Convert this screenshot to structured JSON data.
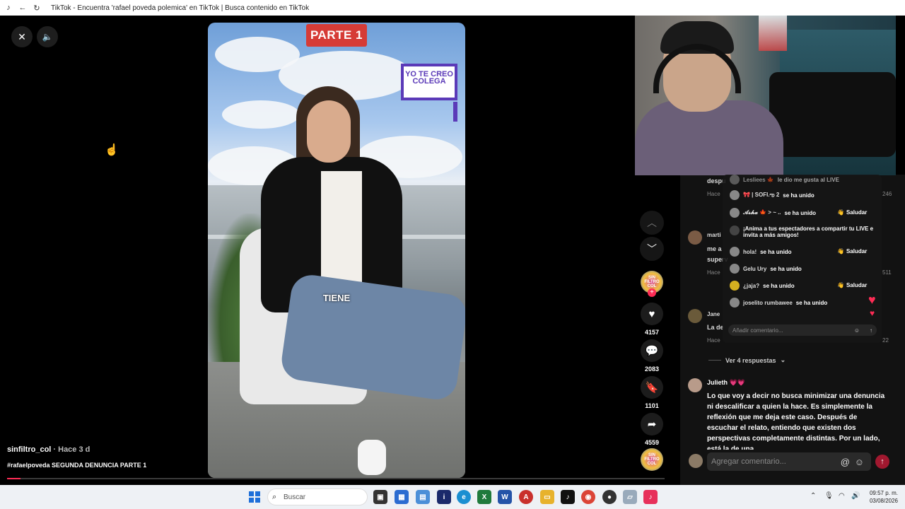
{
  "window": {
    "title": "TikTok - Encuentra 'rafael poveda polemica' en TikTok | Busca contenido en TikTok"
  },
  "video": {
    "parte_label": "PARTE 1",
    "sticker_text": "YO TE CREO COLEGA",
    "caption": "TIENE",
    "author": "sinfiltro_col",
    "posted": "· Hace 3 d",
    "description": "#rafaelpoveda SEGUNDA DENUNCIA PARTE 1",
    "progress_fraction": 0.02
  },
  "actions": {
    "avatar_text": "SIN FILTRO COL",
    "likes": "4157",
    "comments": "2083",
    "saves": "1101",
    "shares": "4559"
  },
  "live_overlay": {
    "rows": [
      {
        "name": "Lesliees 🍁",
        "text": "le dio me gusta al LIVE"
      },
      {
        "name": "🎀 | SOFI.ఌ 2",
        "text": "se ha unido"
      },
      {
        "name": "𝓐𝓼𝓱𝓪 🍁 > ~ ..",
        "text": "se ha unido",
        "button": "Saludar"
      },
      {
        "name": "",
        "text": "¡Anima a tus espectadores a compartir tu LIVE e invita a más amigos!"
      },
      {
        "name": "hola!",
        "text": "se ha unido",
        "button": "Saludar"
      },
      {
        "name": "Gelu Ury",
        "text": "se ha unido"
      },
      {
        "name": "¿jaja?",
        "text": "se ha unido",
        "button": "Saludar"
      },
      {
        "name": "joselito rumbawee",
        "text": "se ha unido"
      }
    ],
    "input_placeholder": "Añadir comentario..."
  },
  "comments_bg": {
    "c1_text": "despu",
    "c1_sub": "Hace",
    "c1_count": "246",
    "c2_name": "marti",
    "c2_text": "me a",
    "c2_text2": "superv",
    "c2_sub": "Hace",
    "c2_count": "511",
    "c3_name": "Jane",
    "c3_text": "La de",
    "c3_sub": "Hace",
    "c3_count": "22"
  },
  "replies": {
    "label": "Ver 4 respuestas"
  },
  "julieth": {
    "name": "Julieth 💗💗",
    "text": "Lo que voy a decir no busca minimizar una denuncia ni descalificar a quien la hace. Es simplemente la reflexión que me deja este caso. Después de escuchar el relato, entiendo que existen dos perspectivas completamente distintas. Por un lado, está la de una"
  },
  "comment_input": {
    "placeholder": "Agregar comentario..."
  },
  "taskbar": {
    "search_placeholder": "Buscar",
    "time": "09:57 p. m.",
    "date": "03/08/2026"
  },
  "colors": {
    "accent": "#fe2c55",
    "panel": "#121212"
  }
}
